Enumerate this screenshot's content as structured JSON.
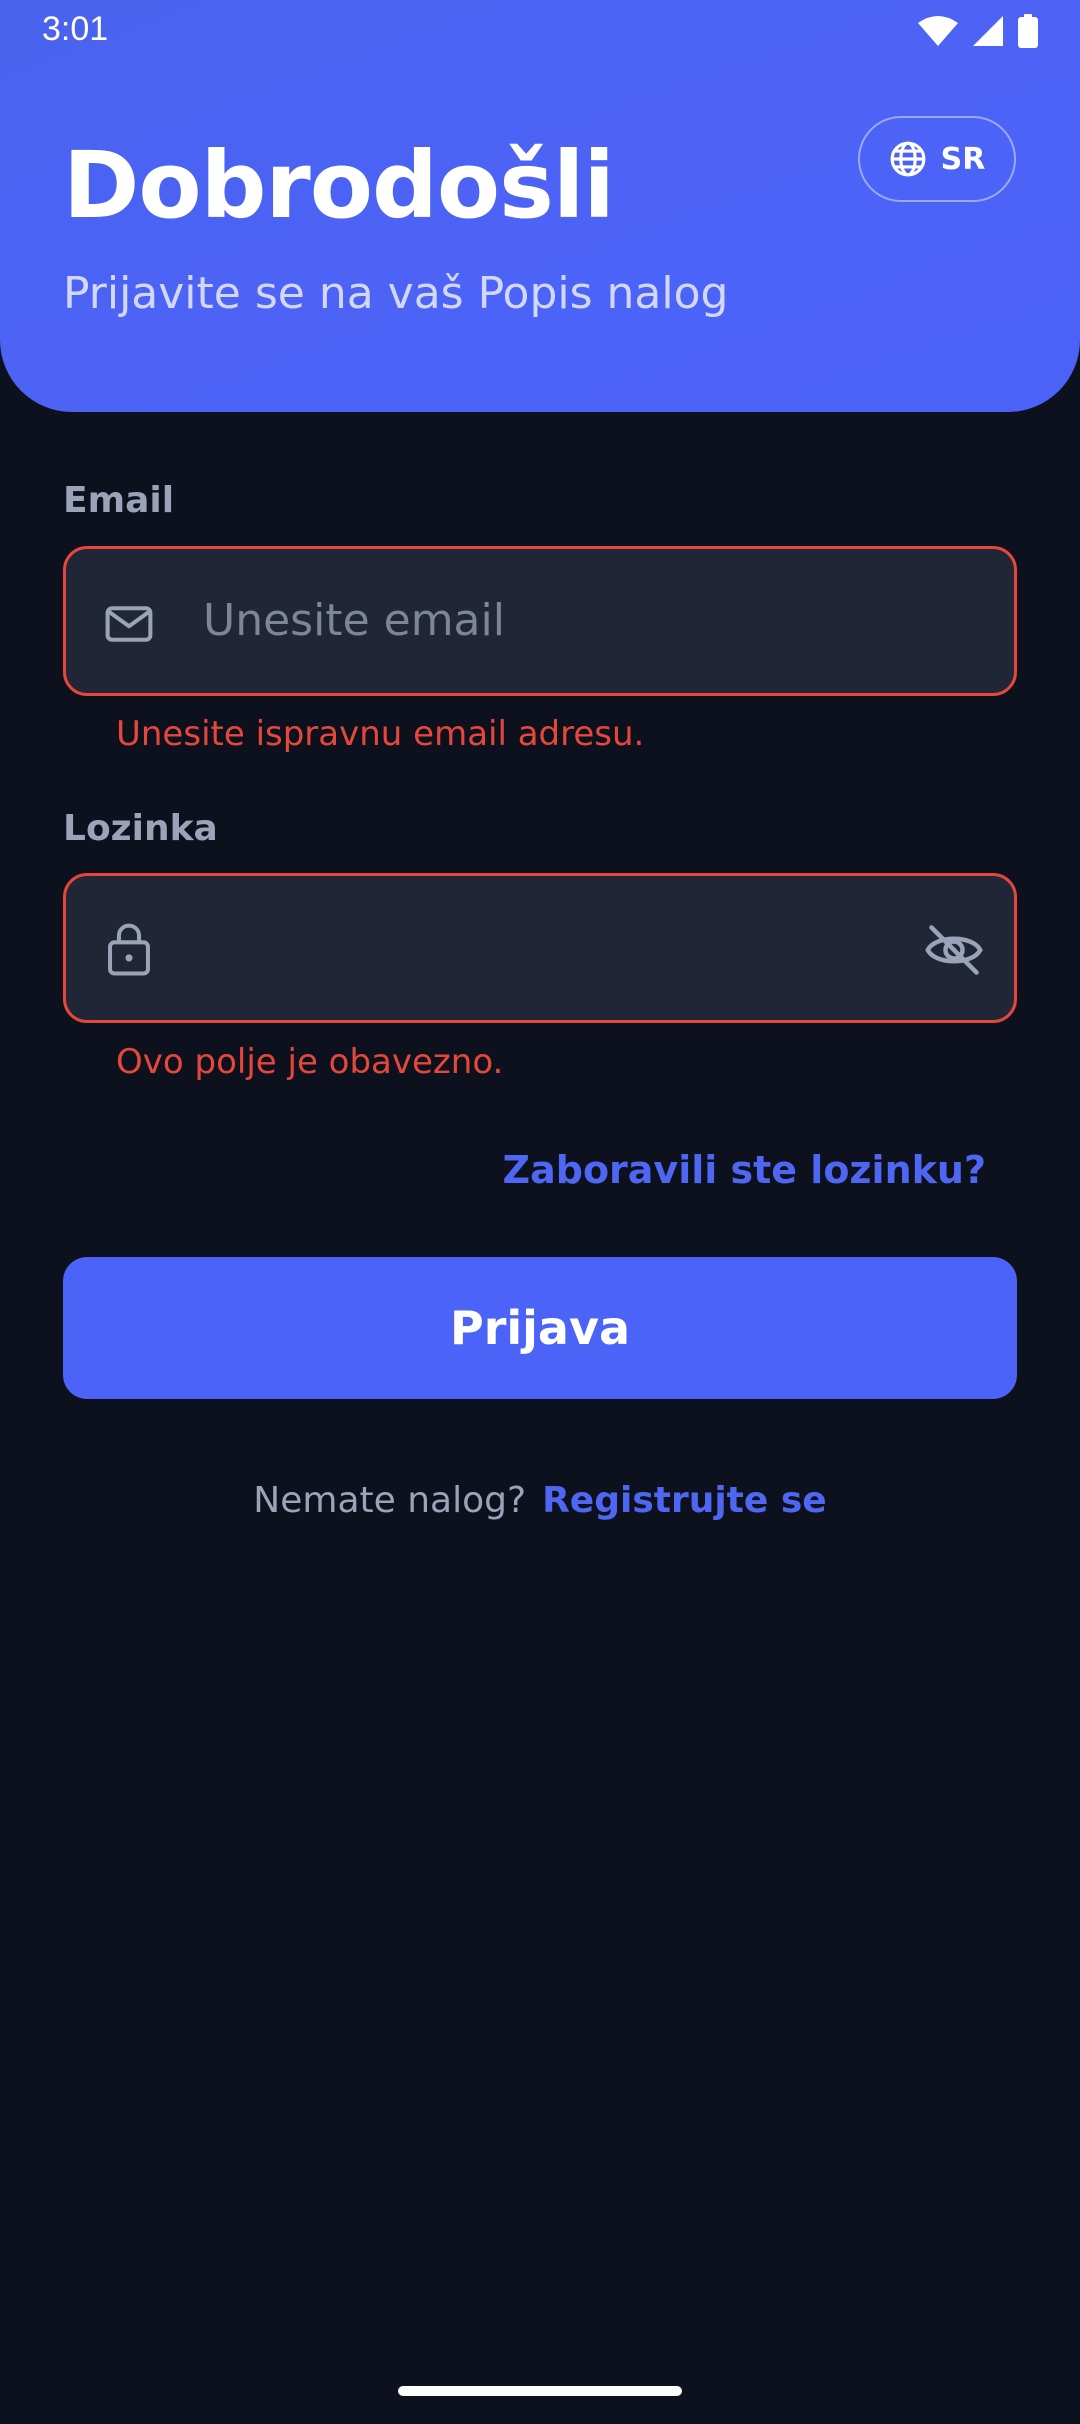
{
  "status_bar": {
    "time": "3:01",
    "icons": [
      "wifi-icon",
      "signal-icon",
      "battery-icon"
    ]
  },
  "header": {
    "title": "Dobrodošli",
    "subtitle": "Prijavite se na vaš Popis nalog",
    "language_button": {
      "icon": "globe-icon",
      "label": "SR"
    }
  },
  "form": {
    "email": {
      "label": "Email",
      "placeholder": "Unesite email",
      "value": "",
      "icon": "mail-icon",
      "error": "Unesite ispravnu email adresu."
    },
    "password": {
      "label": "Lozinka",
      "value": "",
      "icon": "lock-icon",
      "toggle_icon": "eye-off-icon",
      "error": "Ovo polje je obavezno."
    },
    "forgot_password": "Zaboravili ste lozinku?",
    "submit_label": "Prijava",
    "register_prompt": "Nemate nalog?",
    "register_link": "Registrujte se"
  },
  "colors": {
    "background": "#0D111D",
    "accent": "#4B63F6",
    "field_bg": "#212636",
    "error": "#E5473B",
    "muted_text": "#9AA3B8"
  }
}
